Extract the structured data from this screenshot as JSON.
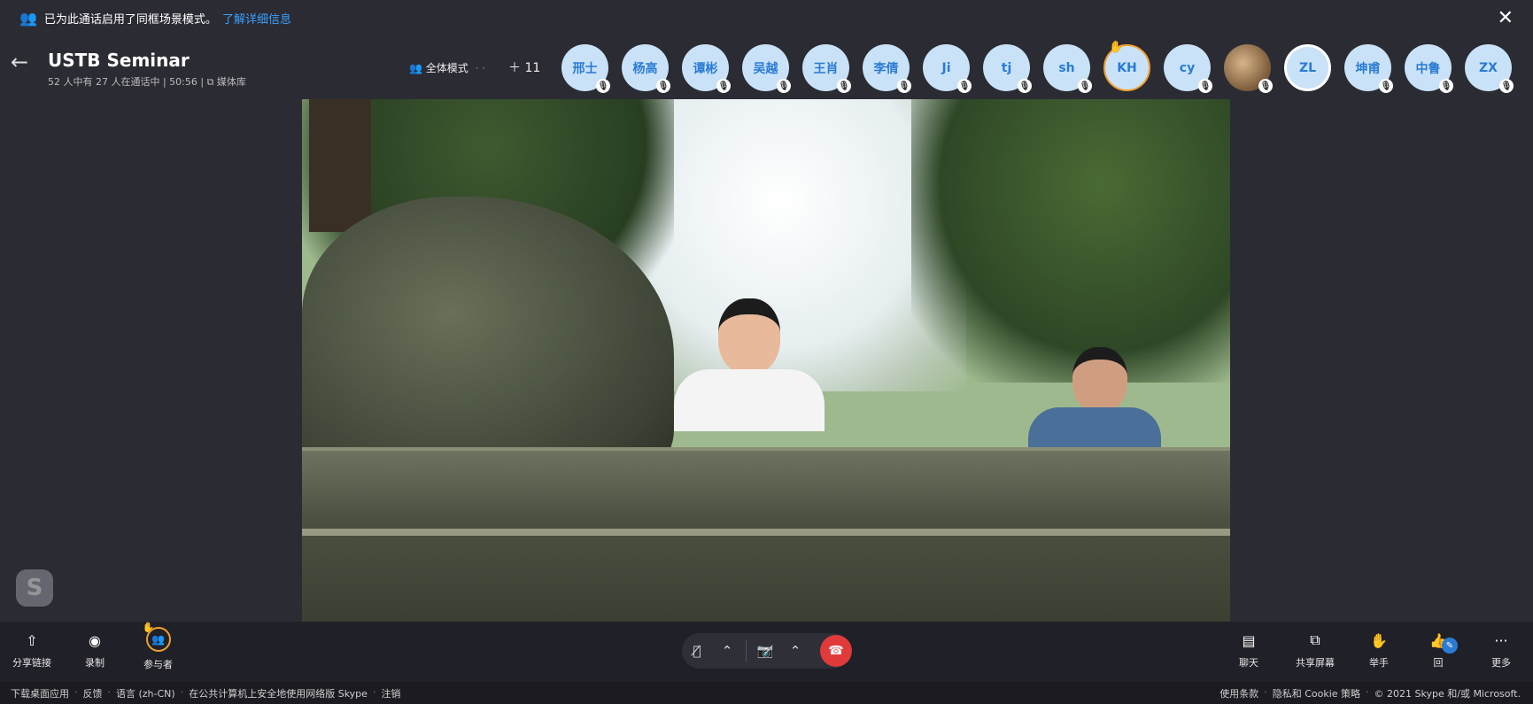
{
  "notice": {
    "text": "已为此通话启用了同框场景模式。",
    "link": "了解详细信息"
  },
  "header": {
    "title": "USTB Seminar",
    "subtitle": "52 人中有 27 人在通话中 | 50:56 | ⧉ 媒体库",
    "mode_label": "全体模式",
    "extra_count": "11"
  },
  "participants": [
    {
      "label": "邢士",
      "muted": true
    },
    {
      "label": "杨高",
      "muted": true
    },
    {
      "label": "谭彬",
      "muted": true
    },
    {
      "label": "吴越",
      "muted": true
    },
    {
      "label": "王肖",
      "muted": true
    },
    {
      "label": "李倩",
      "muted": true
    },
    {
      "label": "Ji",
      "muted": true
    },
    {
      "label": "tj",
      "muted": true
    },
    {
      "label": "sh",
      "muted": true
    },
    {
      "label": "KH",
      "raised_hand": true
    },
    {
      "label": "cy",
      "muted": true
    },
    {
      "label": "",
      "photo": true,
      "muted": true
    },
    {
      "label": "ZL",
      "active": true
    },
    {
      "label": "坤甫",
      "muted": true
    },
    {
      "label": "中鲁",
      "muted": true
    },
    {
      "label": "ZX",
      "muted": true
    }
  ],
  "toolbar": {
    "share_link": "分享链接",
    "record": "录制",
    "participants": "参与者",
    "chat": "聊天",
    "share_screen": "共享屏幕",
    "raise_hand": "举手",
    "react": "回",
    "more": "更多"
  },
  "footer": {
    "left": [
      "下载桌面应用",
      "反馈",
      "语言 (zh-CN)",
      "在公共计算机上安全地使用网络版 Skype",
      "注销"
    ],
    "right": [
      "使用条款",
      "隐私和 Cookie 策略",
      "© 2021 Skype 和/或 Microsoft."
    ]
  },
  "icons": {
    "notice": "people-icon",
    "close": "close-icon",
    "back": "back-arrow-icon",
    "mic": "mic-off-icon",
    "camera": "camera-off-icon",
    "hangup": "hangup-icon"
  },
  "colors": {
    "background": "#2b2b33",
    "accent": "#2a7bd4",
    "hangup": "#e03a3a",
    "raised_hand": "#f0a030"
  }
}
